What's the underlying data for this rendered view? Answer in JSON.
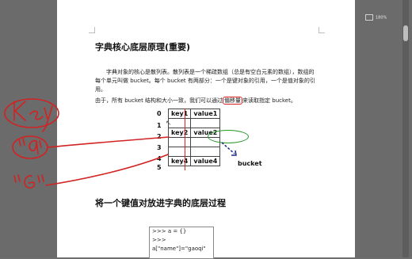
{
  "document": {
    "title": "字典核心底层原理(重要)",
    "para_line1": "字典对象的核心是散列表。散列表是一个稀疏数组（总是有空白元素的数组），数组的",
    "para_line2": "每个单元叫做 bucket。每个 bucket 有两部分：一个是键对象的引用，一个是值对象的引",
    "para_line3": "用。",
    "para4_pre": "由于，所有 bucket 结构和大小一致，我们可以通过",
    "para4_highlight": "偏移量",
    "para4_post": "来读取指定 bucket。",
    "indices": [
      "0",
      "1",
      "2",
      "3",
      "4",
      "5"
    ],
    "rows": [
      {
        "key": "key1",
        "value": "value1"
      },
      {
        "key": "",
        "value": ""
      },
      {
        "key": "key2",
        "value": "value2"
      },
      {
        "key": "",
        "value": ""
      },
      {
        "key": "",
        "value": ""
      },
      {
        "key": "key4",
        "value": "value4"
      }
    ],
    "bucket_label": "bucket",
    "section_title": "将一个键值对放进字典的底层过程",
    "code_lines": [
      ">>> a = {}",
      ">>>",
      "a[\"name\"]=\"gaoqi\""
    ],
    "cut_text": "…………………………………………"
  },
  "annotations": {
    "handwriting": [
      "Key",
      "\"a\"",
      "\"G\""
    ]
  },
  "viewer": {
    "zoom": "180%"
  },
  "colors": {
    "ink_red": "#d22222",
    "ink_green": "#2a9a2a",
    "ink_blue": "#1a2a8a"
  }
}
